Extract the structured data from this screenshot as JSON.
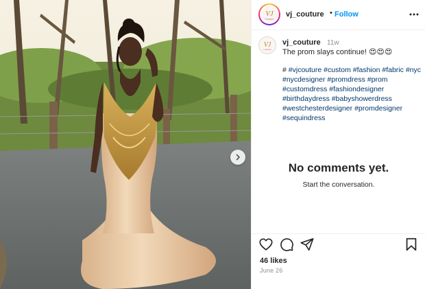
{
  "header": {
    "username": "vj_couture",
    "separator": "•",
    "follow_label": "Follow",
    "more_icon": "more-horizontal-icon"
  },
  "brand": {
    "logo_text": "VJ",
    "logo_subtext": "Couture",
    "logo_color": "#b8863b",
    "story_ring_colors": [
      "#f9ce34",
      "#ee2a7b",
      "#6228d7"
    ]
  },
  "caption": {
    "username": "vj_couture",
    "time_ago": "11w",
    "text": "The prom slays continue! 😍😍😍"
  },
  "hashtags": {
    "lead": "#",
    "tags": [
      "#vjcouture",
      "#custom",
      "#fashion",
      "#fabric",
      "#nyc",
      "#nycdesigner",
      "#promdress",
      "#prom",
      "#customdress",
      "#fashiondesigner",
      "#birthdaydress",
      "#babyshowerdress",
      "#westchesterdesigner",
      "#promdesigner",
      "#sequindress"
    ]
  },
  "comments": {
    "empty_title": "No comments yet.",
    "empty_subtitle": "Start the conversation."
  },
  "actions": {
    "icons": [
      "heart-icon",
      "comment-icon",
      "share-icon",
      "bookmark-icon"
    ]
  },
  "stats": {
    "likes": "46 likes",
    "date": "June 26"
  },
  "media": {
    "next_icon": "chevron-right-icon",
    "dress_color": "#e8c7a2",
    "embellishment_color": "#c29a3f"
  },
  "colors": {
    "link_blue": "#0095f6",
    "hashtag_blue": "#00376b",
    "text": "#262626",
    "muted": "#8e8e8e"
  }
}
